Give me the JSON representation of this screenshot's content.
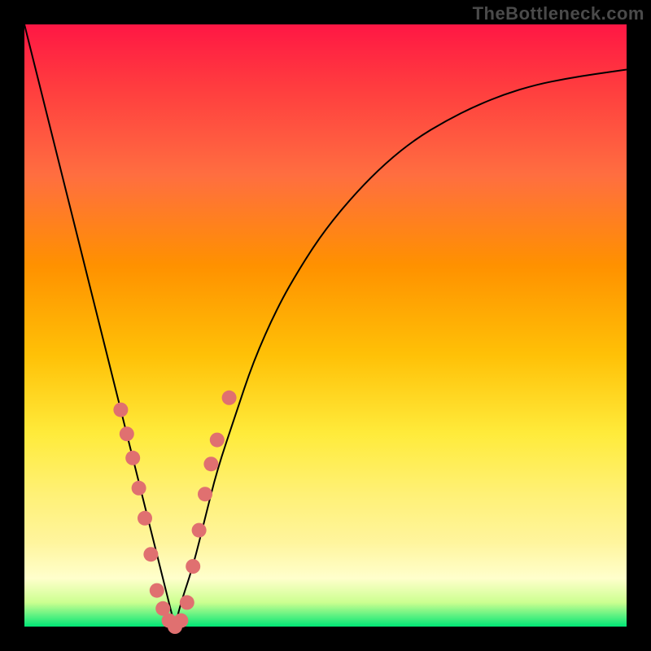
{
  "watermark": "TheBottleneck.com",
  "colors": {
    "background": "#000000",
    "curve": "#000000",
    "marker": "#e07070"
  },
  "chart_data": {
    "type": "line",
    "title": "",
    "xlabel": "",
    "ylabel": "",
    "xlim": [
      0,
      100
    ],
    "ylim": [
      0,
      100
    ],
    "grid": false,
    "legend": false,
    "series": [
      {
        "name": "bottleneck-curve",
        "x": [
          0,
          2,
          4,
          6,
          8,
          10,
          12,
          14,
          16,
          18,
          20,
          22,
          23,
          24,
          25,
          26,
          28,
          30,
          32,
          35,
          38,
          42,
          46,
          50,
          55,
          60,
          65,
          70,
          75,
          80,
          85,
          90,
          95,
          100
        ],
        "y": [
          100,
          92,
          84,
          76,
          68,
          60,
          52,
          44,
          36,
          28,
          20,
          12,
          8,
          4,
          0,
          4,
          10,
          18,
          26,
          35,
          44,
          53,
          60,
          66,
          72,
          77,
          81,
          84,
          86.5,
          88.5,
          90,
          91,
          91.8,
          92.5
        ]
      }
    ],
    "markers": {
      "name": "highlighted-points",
      "points": [
        {
          "x": 16,
          "y": 36
        },
        {
          "x": 17,
          "y": 32
        },
        {
          "x": 18,
          "y": 28
        },
        {
          "x": 19,
          "y": 23
        },
        {
          "x": 20,
          "y": 18
        },
        {
          "x": 21,
          "y": 12
        },
        {
          "x": 22,
          "y": 6
        },
        {
          "x": 23,
          "y": 3
        },
        {
          "x": 24,
          "y": 1
        },
        {
          "x": 25,
          "y": 0
        },
        {
          "x": 26,
          "y": 1
        },
        {
          "x": 27,
          "y": 4
        },
        {
          "x": 28,
          "y": 10
        },
        {
          "x": 29,
          "y": 16
        },
        {
          "x": 30,
          "y": 22
        },
        {
          "x": 31,
          "y": 27
        },
        {
          "x": 32,
          "y": 31
        },
        {
          "x": 34,
          "y": 38
        }
      ]
    }
  }
}
